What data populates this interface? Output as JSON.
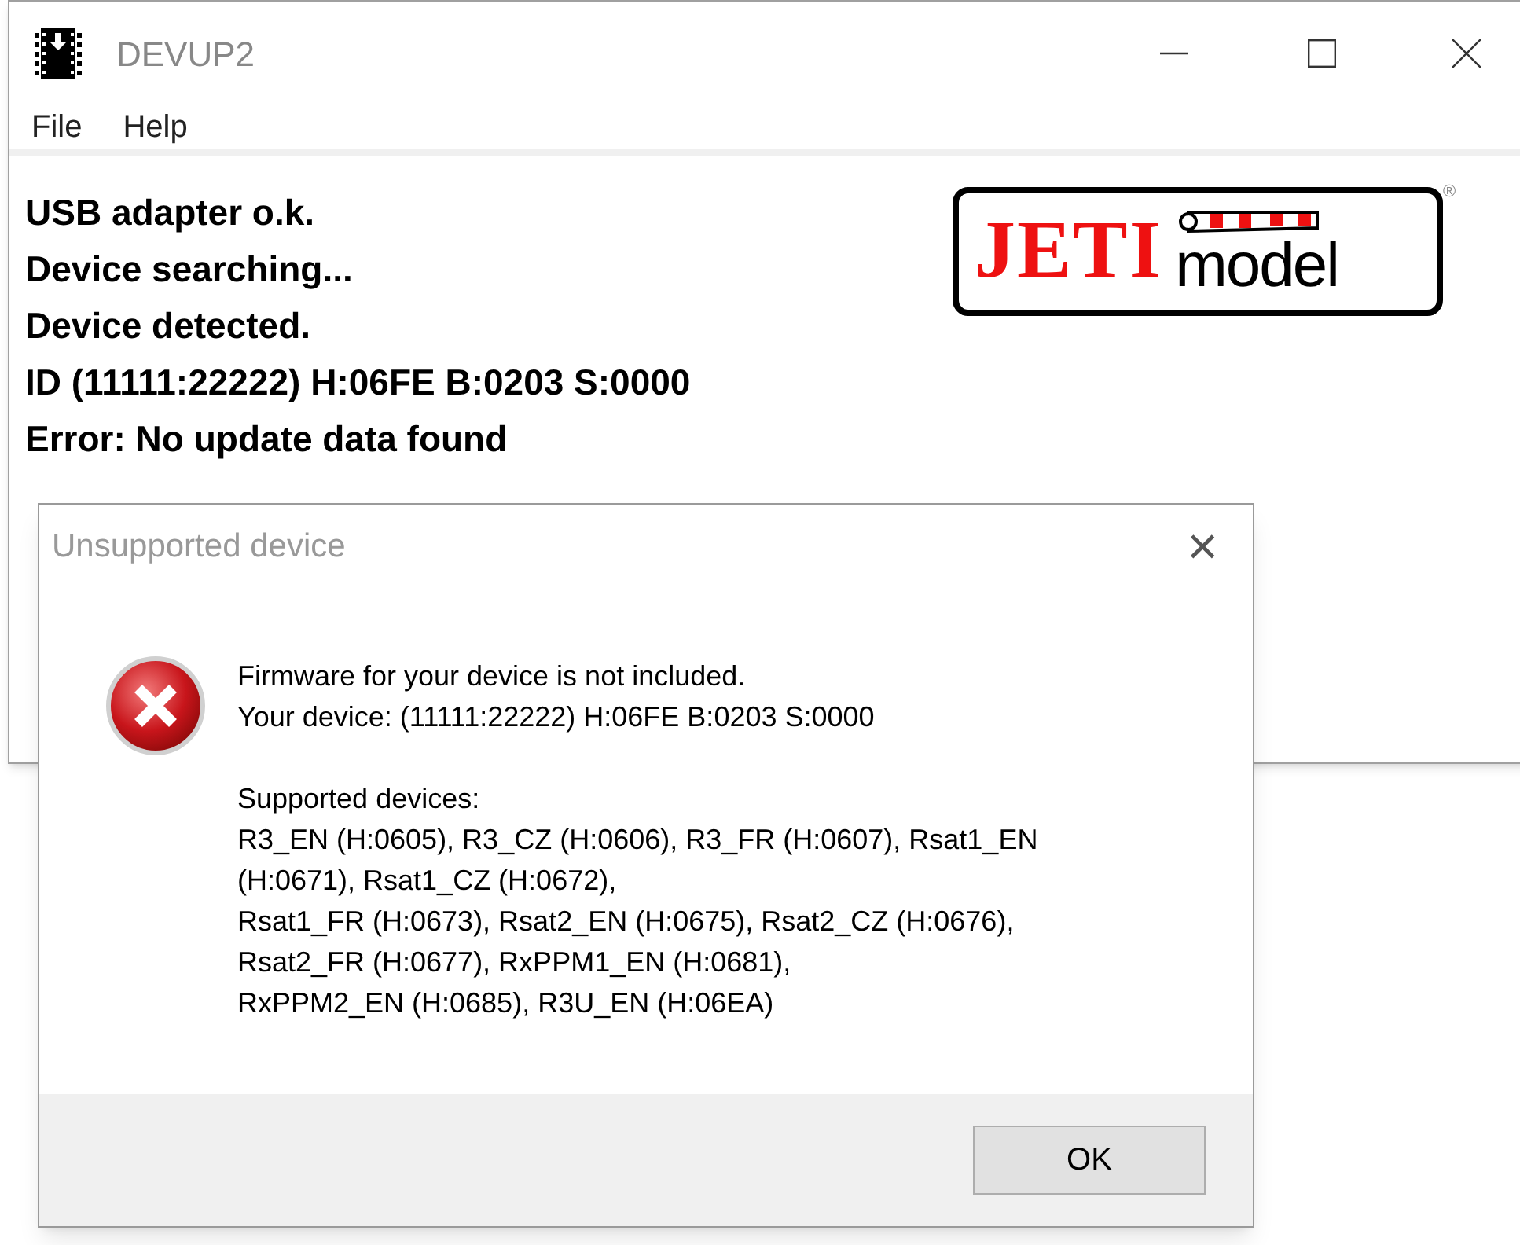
{
  "main_window": {
    "title": "DEVUP2",
    "menu": [
      "File",
      "Help"
    ],
    "log": [
      "USB adapter o.k.",
      "Device searching...",
      "Device detected.",
      "ID (11111:22222) H:06FE B:0203 S:0000",
      "Error: No update data found"
    ],
    "logo": {
      "brand": "JETI",
      "word": "model",
      "mark": "®"
    }
  },
  "dialog": {
    "title": "Unsupported device",
    "close": "×",
    "message": [
      "Firmware for your device is not included.",
      "Your device: (11111:22222) H:06FE B:0203 S:0000"
    ],
    "supported_heading": "Supported devices:",
    "supported_lines": [
      "R3_EN (H:0605), R3_CZ (H:0606), R3_FR (H:0607), Rsat1_EN",
      "(H:0671), Rsat1_CZ (H:0672),",
      "Rsat1_FR (H:0673), Rsat2_EN (H:0675), Rsat2_CZ (H:0676),",
      "Rsat2_FR (H:0677), RxPPM1_EN (H:0681),",
      "RxPPM2_EN (H:0685), R3U_EN (H:06EA)"
    ],
    "button": "OK"
  }
}
